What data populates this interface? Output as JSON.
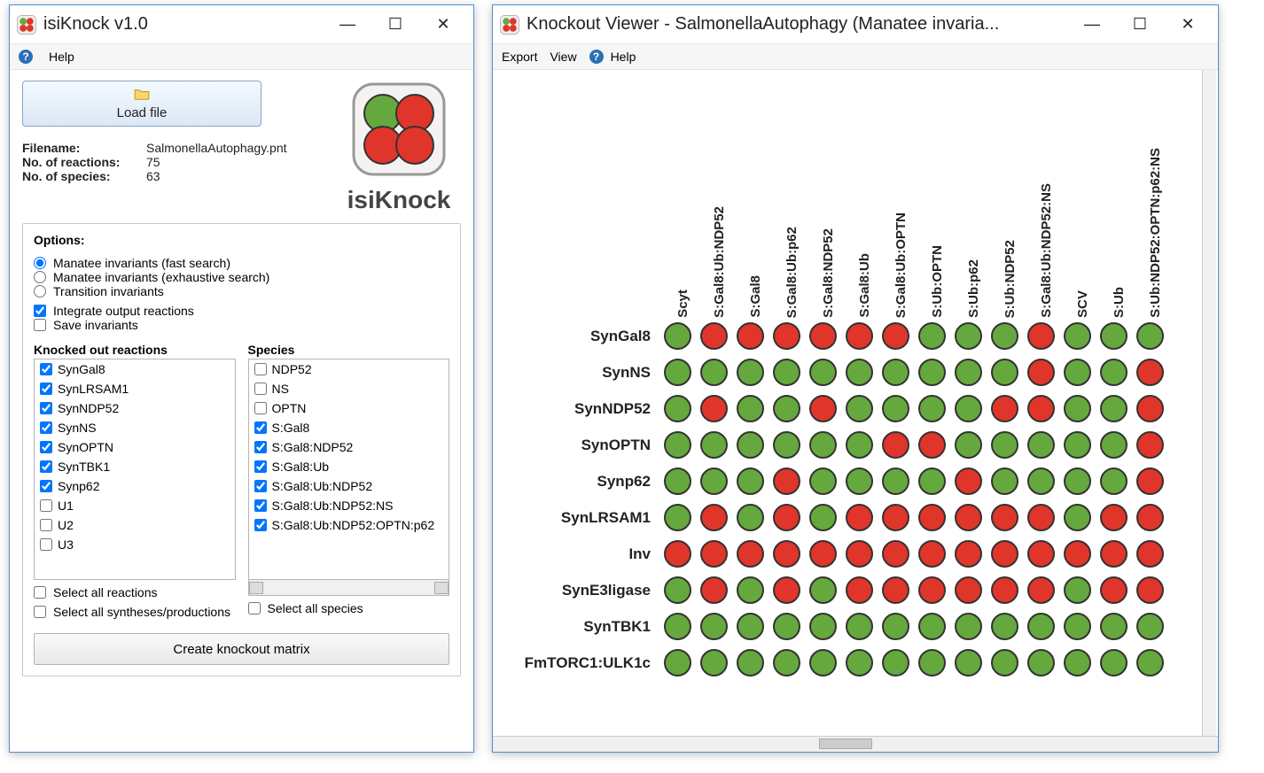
{
  "win1": {
    "title": "isiKnock v1.0",
    "winbtns": {
      "min": "—",
      "max": "☐",
      "close": "✕"
    },
    "menu": {
      "help": "Help"
    },
    "load_button": "Load file",
    "info": {
      "filename_label": "Filename:",
      "filename_value": "SalmonellaAutophagy.pnt",
      "reactions_label": "No. of reactions:",
      "reactions_value": "75",
      "species_label": "No. of species:",
      "species_value": "63"
    },
    "logo_text": "isiKnock",
    "options": {
      "title": "Options:",
      "radio": [
        {
          "label": "Manatee invariants (fast search)",
          "checked": true
        },
        {
          "label": "Manatee invariants (exhaustive search)",
          "checked": false
        },
        {
          "label": "Transition invariants",
          "checked": false
        }
      ],
      "checks": [
        {
          "label": "Integrate output reactions",
          "checked": true
        },
        {
          "label": "Save invariants",
          "checked": false
        }
      ]
    },
    "reactions": {
      "title": "Knocked out reactions",
      "items": [
        {
          "label": "SynGal8",
          "checked": true
        },
        {
          "label": "SynLRSAM1",
          "checked": true
        },
        {
          "label": "SynNDP52",
          "checked": true
        },
        {
          "label": "SynNS",
          "checked": true
        },
        {
          "label": "SynOPTN",
          "checked": true
        },
        {
          "label": "SynTBK1",
          "checked": true
        },
        {
          "label": "Synp62",
          "checked": true
        },
        {
          "label": "U1",
          "checked": false
        },
        {
          "label": "U2",
          "checked": false
        },
        {
          "label": "U3",
          "checked": false
        }
      ],
      "select_all": "Select all reactions",
      "select_syn": "Select all syntheses/productions"
    },
    "species": {
      "title": "Species",
      "items": [
        {
          "label": "NDP52",
          "checked": false
        },
        {
          "label": "NS",
          "checked": false
        },
        {
          "label": "OPTN",
          "checked": false
        },
        {
          "label": "S:Gal8",
          "checked": true
        },
        {
          "label": "S:Gal8:NDP52",
          "checked": true
        },
        {
          "label": "S:Gal8:Ub",
          "checked": true
        },
        {
          "label": "S:Gal8:Ub:NDP52",
          "checked": true
        },
        {
          "label": "S:Gal8:Ub:NDP52:NS",
          "checked": true
        },
        {
          "label": "S:Gal8:Ub:NDP52:OPTN:p62",
          "checked": true
        }
      ],
      "select_all": "Select all species"
    },
    "create_button": "Create knockout matrix"
  },
  "win2": {
    "title": "Knockout Viewer - SalmonellaAutophagy (Manatee invaria...",
    "winbtns": {
      "min": "—",
      "max": "☐",
      "close": "✕"
    },
    "menu": {
      "export": "Export",
      "view": "View",
      "help": "Help"
    },
    "columns": [
      "Scyt",
      "S:Gal8:Ub:NDP52",
      "S:Gal8",
      "S:Gal8:Ub:p62",
      "S:Gal8:NDP52",
      "S:Gal8:Ub",
      "S:Gal8:Ub:OPTN",
      "S:Ub:OPTN",
      "S:Ub:p62",
      "S:Ub:NDP52",
      "S:Gal8:Ub:NDP52:NS",
      "SCV",
      "S:Ub",
      "S:Ub:NDP52:OPTN:p62:NS"
    ],
    "rows": [
      {
        "label": "SynGal8",
        "cells": [
          "g",
          "r",
          "r",
          "r",
          "r",
          "r",
          "r",
          "g",
          "g",
          "g",
          "r",
          "g",
          "g",
          "g"
        ]
      },
      {
        "label": "SynNS",
        "cells": [
          "g",
          "g",
          "g",
          "g",
          "g",
          "g",
          "g",
          "g",
          "g",
          "g",
          "r",
          "g",
          "g",
          "r"
        ]
      },
      {
        "label": "SynNDP52",
        "cells": [
          "g",
          "r",
          "g",
          "g",
          "r",
          "g",
          "g",
          "g",
          "g",
          "r",
          "r",
          "g",
          "g",
          "r"
        ]
      },
      {
        "label": "SynOPTN",
        "cells": [
          "g",
          "g",
          "g",
          "g",
          "g",
          "g",
          "r",
          "r",
          "g",
          "g",
          "g",
          "g",
          "g",
          "r"
        ]
      },
      {
        "label": "Synp62",
        "cells": [
          "g",
          "g",
          "g",
          "r",
          "g",
          "g",
          "g",
          "g",
          "r",
          "g",
          "g",
          "g",
          "g",
          "r"
        ]
      },
      {
        "label": "SynLRSAM1",
        "cells": [
          "g",
          "r",
          "g",
          "r",
          "g",
          "r",
          "r",
          "r",
          "r",
          "r",
          "r",
          "g",
          "r",
          "r"
        ]
      },
      {
        "label": "Inv",
        "cells": [
          "r",
          "r",
          "r",
          "r",
          "r",
          "r",
          "r",
          "r",
          "r",
          "r",
          "r",
          "r",
          "r",
          "r"
        ]
      },
      {
        "label": "SynE3ligase",
        "cells": [
          "g",
          "r",
          "g",
          "r",
          "g",
          "r",
          "r",
          "r",
          "r",
          "r",
          "r",
          "g",
          "r",
          "r"
        ]
      },
      {
        "label": "SynTBK1",
        "cells": [
          "g",
          "g",
          "g",
          "g",
          "g",
          "g",
          "g",
          "g",
          "g",
          "g",
          "g",
          "g",
          "g",
          "g"
        ]
      },
      {
        "label": "FmTORC1:ULK1c",
        "cells": [
          "g",
          "g",
          "g",
          "g",
          "g",
          "g",
          "g",
          "g",
          "g",
          "g",
          "g",
          "g",
          "g",
          "g"
        ]
      }
    ]
  }
}
